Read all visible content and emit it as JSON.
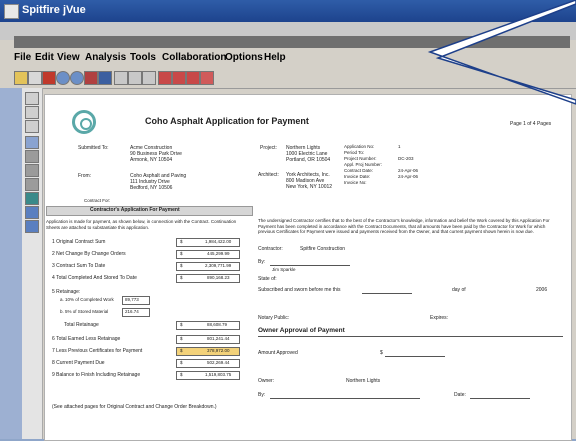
{
  "window": {
    "title": "Spitfire jVue"
  },
  "menu": [
    "File",
    "Edit",
    "View",
    "Analysis",
    "Tools",
    "Collaboration",
    "Options",
    "Help"
  ],
  "doc": {
    "title": "Coho Asphalt Application for Payment",
    "page": "Page 1 of 4 Pages",
    "submitted_to_label": "Submitted To:",
    "submitted_to": [
      "Acme Construction",
      "90 Business Park Drive",
      "Armonk, NY 10504"
    ],
    "from_label": "From:",
    "from": [
      "Coho Asphalt and Paving",
      "111 Industry Drive",
      "Bedford, NY 10506"
    ],
    "project_label": "Project:",
    "project": [
      "Northern Lights",
      "1000 Electric Lane",
      "Portland, OR 10504"
    ],
    "architect_label": "Architect:",
    "architect": [
      "York Architects, Inc.",
      "800 Madison Ave",
      "New York, NY 10012"
    ],
    "contract_for": "Contract For:",
    "right_fields": [
      "Application No:",
      "Period To:",
      "Project Number:",
      "Appl. Proj Number:",
      "Contract Date:",
      "Invoice Date:",
      "Invoice No:"
    ],
    "right_values": [
      "1",
      "",
      "DC-203",
      "",
      "24-Apr-06",
      "24-Apr-06",
      ""
    ],
    "section_title": "Contractor's Application For Payment",
    "intro": "Application is made for payment, as shown below, in connection with the Contract. Continuation Sheets are attached to substantiate this application.",
    "lines": [
      {
        "label": "1 Original Contract Sum",
        "val": "1,984,422.00"
      },
      {
        "label": "2 Net Change By Change Orders",
        "val": "445,299.99"
      },
      {
        "label": "3 Contract Sum To Date",
        "val": "2,309,771.99"
      },
      {
        "label": "4 Total Completed And Stored To Date",
        "val": "890,168.23"
      }
    ],
    "retainage_label": "5 Retainage:",
    "ret_a": "a. 10% of Completed Work",
    "ret_a_val": "89,773",
    "ret_b": "b. 5% of Stored Material",
    "ret_b_val": "216.74",
    "total_ret_label": "Total Retainage",
    "total_ret_val": "88,608.79",
    "lines2": [
      {
        "label": "6 Total Earned Less Retainage",
        "val": "801,241.44"
      },
      {
        "label": "7 Less Previous Certificates for Payment",
        "val": "378,972.00"
      },
      {
        "label": "8 Current Payment Due",
        "val": "502,269.44"
      },
      {
        "label": "9 Balance to Finish Including Retainage",
        "val": "1,519,803.75"
      }
    ],
    "attached_note": "(See attached pages for Original Contract and Change Order Breakdown.)",
    "cert_text": "The undersigned Contractor certifies that to the best of the Contractor's knowledge, information and belief the Work covered by this Application For Payment has been completed in accordance with the Contract Documents, that all amounts have been paid by the Contractor for Work for which previous Certificates for Payment were issued and payments received from the Owner, and that current payment shown herein is now due.",
    "contractor_label": "Contractor:",
    "contractor": "Spitfire Construction",
    "by_label": "By:",
    "signer": "Jim Sparkle",
    "state_label": "State of:",
    "subscribed": "Subscribed and sworn before me this",
    "day_of": "day of",
    "year": "2006",
    "notary_label": "Notary Public:",
    "expires_label": "Expires:",
    "owner_head": "Owner Approval of Payment",
    "amount_label": "Amount Approved",
    "owner_label": "Owner:",
    "owner": "Northern Lights",
    "date_label": "Date:"
  },
  "colors": {
    "title_bar": "#1d438d",
    "menu_bg": "#d4d0c8",
    "logo": "#5aa8a8"
  }
}
